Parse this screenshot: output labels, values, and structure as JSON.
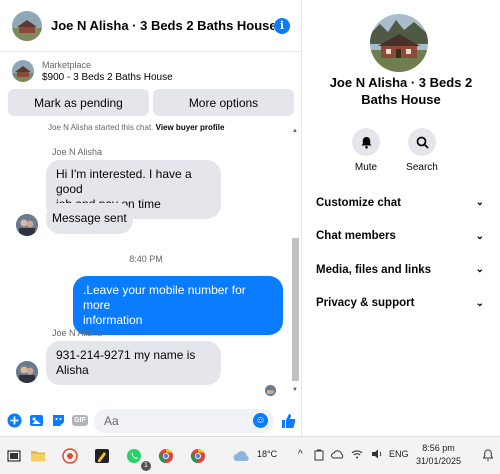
{
  "header": {
    "title": "Joe N Alisha · 3 Beds 2 Baths House",
    "info_glyph": "i"
  },
  "marketplace": {
    "label": "Marketplace",
    "listing": "$900 - 3 Beds 2 Baths House",
    "mark_pending": "Mark as pending",
    "more_options": "More options"
  },
  "conversation": {
    "system_text": "Joe N Alisha started this chat.",
    "system_link": "View buyer profile",
    "sender_name": "Joe N Alisha",
    "msg1_line1": "Hi I'm interested. I have a good",
    "msg1_line2": "job and pay on time",
    "msg2": "Message sent",
    "timestamp": "8:40 PM",
    "out_line1": ".Leave your mobile number for more",
    "out_line2": "information",
    "msg3_line1": "931-214-9271 my name is",
    "msg3_line2": "Alisha"
  },
  "composer": {
    "placeholder": "Aa",
    "gif": "GIF"
  },
  "side": {
    "title_line1": "Joe N Alisha · 3 Beds 2",
    "title_line2": "Baths House",
    "mute": "Mute",
    "search": "Search",
    "menu": [
      "Customize chat",
      "Chat members",
      "Media, files and links",
      "Privacy & support"
    ]
  },
  "taskbar": {
    "temp": "18°C",
    "lang": "ENG",
    "time": "8:56 pm",
    "date": "31/01/2025",
    "badge": "1"
  },
  "colors": {
    "accent": "#0a7cff",
    "bubble_in": "#e4e6eb"
  }
}
